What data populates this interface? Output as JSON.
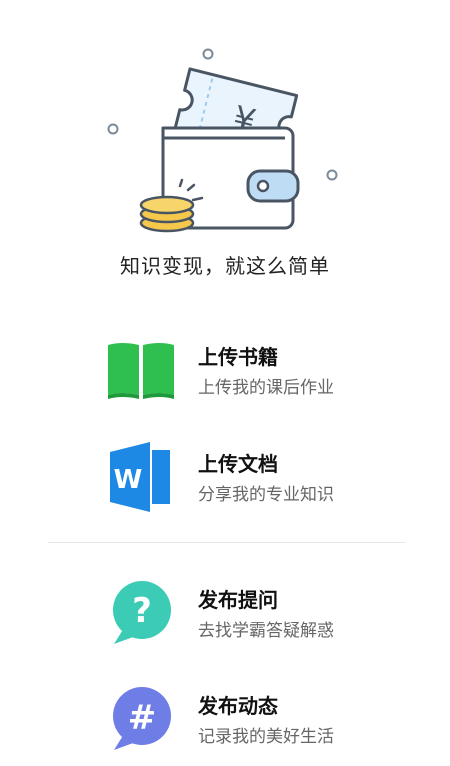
{
  "hero": {
    "tagline": "知识变现，就这么简单",
    "currency_symbol": "¥"
  },
  "menu": [
    {
      "title": "上传书籍",
      "subtitle": "上传我的课后作业",
      "icon": "green-book-icon",
      "color": "#2fbf4f"
    },
    {
      "title": "上传文档",
      "subtitle": "分享我的专业知识",
      "icon": "word-document-icon",
      "color": "#1e88e5"
    },
    {
      "title": "发布提问",
      "subtitle": "去找学霸答疑解惑",
      "icon": "question-bubble-icon",
      "color": "#3ccbb4"
    },
    {
      "title": "发布动态",
      "subtitle": "记录我的美好生活",
      "icon": "hashtag-bubble-icon",
      "color": "#6f7ee6"
    }
  ]
}
